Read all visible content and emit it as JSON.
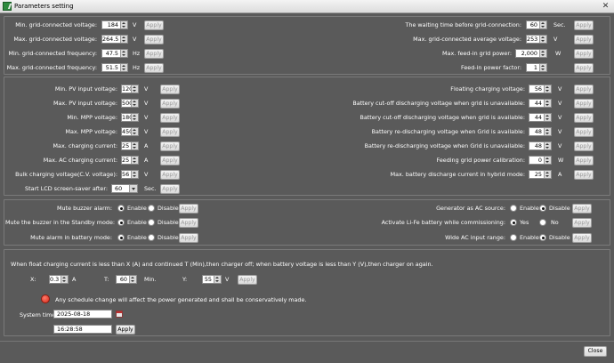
{
  "window": {
    "title": "Parameters setting",
    "close_glyph": "✕"
  },
  "grid": {
    "left": [
      {
        "label": "Min. grid-connected voltage:",
        "value": "184",
        "unit": "V",
        "button": "Apply"
      },
      {
        "label": "Max. grid-connected voltage:",
        "value": "264.5",
        "unit": "V",
        "button": "Apply"
      },
      {
        "label": "Min. grid-connected frequency:",
        "value": "47.5",
        "unit": "Hz",
        "button": "Apply"
      },
      {
        "label": "Max. grid-connected frequency:",
        "value": "51.5",
        "unit": "Hz",
        "button": "Apply"
      }
    ],
    "right": [
      {
        "label": "The waiting time before grid-connection:",
        "value": "60",
        "unit": "Sec.",
        "button": "Apply"
      },
      {
        "label": "Max. grid-connected average voltage:",
        "value": "253",
        "unit": "V",
        "button": "Apply"
      },
      {
        "label": "Max. feed-in grid power:",
        "value": "2,000",
        "unit": "W",
        "button": "Apply"
      },
      {
        "label": "Feed-in power factor:",
        "value": "1",
        "unit": "",
        "button": "Apply"
      }
    ]
  },
  "charging": {
    "left": [
      {
        "label": "Min. PV input voltage:",
        "value": "120",
        "unit": "V",
        "button": "Apply"
      },
      {
        "label": "Max. PV input voltage:",
        "value": "500",
        "unit": "V",
        "button": "Apply"
      },
      {
        "label": "Min. MPP voltage:",
        "value": "180",
        "unit": "V",
        "button": "Apply"
      },
      {
        "label": "Max. MPP voltage:",
        "value": "450",
        "unit": "V",
        "button": "Apply"
      },
      {
        "label": "Max. charging current:",
        "value": "25",
        "unit": "A",
        "button": "Apply"
      },
      {
        "label": "Max. AC charging current:",
        "value": "25",
        "unit": "A",
        "button": "Apply"
      },
      {
        "label": "Bulk charging voltage(C.V. voltage):",
        "value": "56",
        "unit": "V",
        "button": "Apply"
      }
    ],
    "screensaver": {
      "label": "Start LCD screen-saver after:",
      "value": "60",
      "unit": "Sec.",
      "button": "Apply"
    },
    "right": [
      {
        "label": "Floating charging voltage:",
        "value": "56",
        "unit": "V",
        "button": "Apply"
      },
      {
        "label": "Battery cut-off discharging voltage when grid is unavailable:",
        "value": "44",
        "unit": "V",
        "button": "Apply"
      },
      {
        "label": "Battery cut-off discharging voltage when grid is available:",
        "value": "44",
        "unit": "V",
        "button": "Apply"
      },
      {
        "label": "Battery re-discharging voltage when Grid is available:",
        "value": "48",
        "unit": "V",
        "button": "Apply"
      },
      {
        "label": "Battery re-discharging voltage when Grid is unavailable:",
        "value": "48",
        "unit": "V",
        "button": "Apply"
      },
      {
        "label": "Feeding grid power calibration:",
        "value": "0",
        "unit": "W",
        "button": "Apply"
      },
      {
        "label": "Max. battery discharge current in hybrid mode:",
        "value": "25",
        "unit": "A",
        "button": "Apply"
      }
    ]
  },
  "toggles": {
    "enable": "Enable",
    "disable": "Disable",
    "yes": "Yes",
    "no": "No",
    "apply": "Apply",
    "left": [
      {
        "label": "Mute buzzer alarm:",
        "selected": "enable"
      },
      {
        "label": "Mute the buzzer in the Standby mode:",
        "selected": "enable"
      },
      {
        "label": "Mute alarm in battery mode:",
        "selected": "enable"
      }
    ],
    "right": [
      {
        "label": "Generator as AC source:",
        "selected": "disable",
        "kind": "enable"
      },
      {
        "label": "Activate Li-Fe battery while commissioning:",
        "selected": "yes",
        "kind": "yes"
      },
      {
        "label": "Wide AC input range:",
        "selected": "disable",
        "kind": "enable"
      }
    ]
  },
  "float_charge": {
    "description": "When float charging current is less than X (A) and continued T (Min),then charger off; when battery voltage is less than Y (V),then charger on again.",
    "x_label": "X:",
    "x_value": "0.3",
    "x_unit": "A",
    "t_label": "T:",
    "t_value": "60",
    "t_unit": "Min.",
    "y_label": "Y:",
    "y_value": "55",
    "y_unit": "V",
    "button": "Apply"
  },
  "schedule": {
    "warning": "Any schedule change will affect the power generated and shall be conservatively made.",
    "system_time_label": "System time:",
    "date": "2025-08-18",
    "time": "16:28:58",
    "button": "Apply"
  },
  "footer": {
    "close_label": "Close"
  }
}
